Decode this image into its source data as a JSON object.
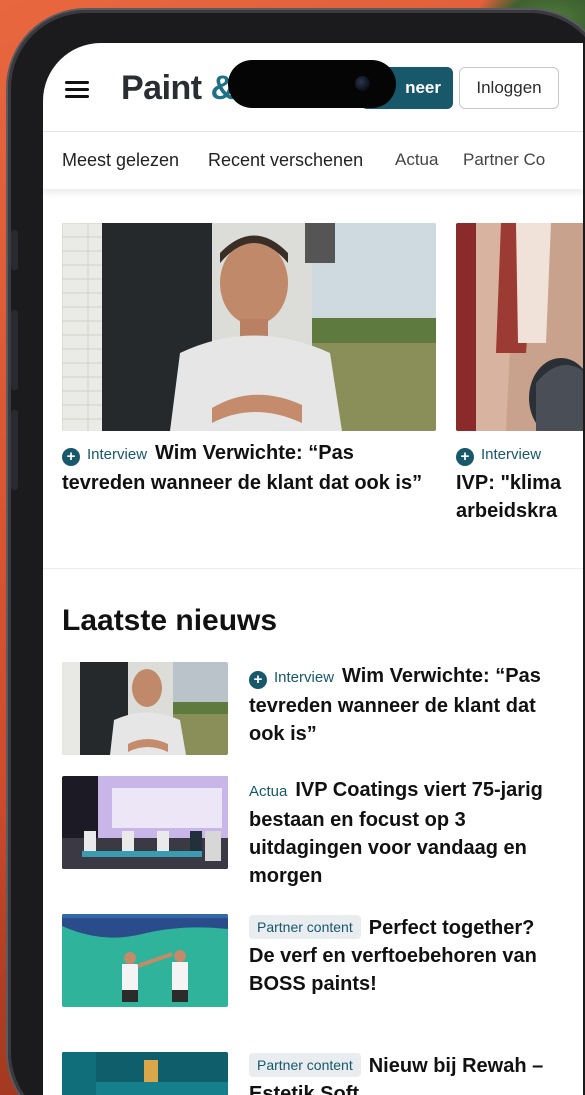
{
  "header": {
    "logo_text": "Paint",
    "logo_amp": "&",
    "subscribe_label": "neer",
    "login_label": "Inloggen"
  },
  "nav": {
    "items": [
      "Meest gelezen",
      "Recent verschenen",
      "Actua",
      "Partner Co"
    ]
  },
  "carousel": [
    {
      "tag": "Interview",
      "title": "Wim Verwichte: “Pas tevreden wanneer de klant dat ook is”"
    },
    {
      "tag": "Interview",
      "title": "IVP: \"klima",
      "title_line2": "arbeidskra"
    }
  ],
  "latest": {
    "heading": "Laatste nieuws",
    "items": [
      {
        "tag": "Interview",
        "tag_style": "icon",
        "title": "Wim Verwichte: “Pas tevreden wanneer de klant dat ook is”"
      },
      {
        "tag": "Actua",
        "tag_style": "plain",
        "title": "IVP Coatings viert 75-jarig bestaan en focust op 3 uitdagingen voor vandaag en morgen"
      },
      {
        "tag": "Partner content",
        "tag_style": "pill",
        "title": "Perfect together? De verf en verftoebehoren van BOSS paints!"
      },
      {
        "tag": "Partner content",
        "tag_style": "pill",
        "title": "Nieuw bij Rewah – Estetik Soft"
      }
    ]
  },
  "colors": {
    "accent": "#17586b",
    "background": "#d9542f"
  }
}
